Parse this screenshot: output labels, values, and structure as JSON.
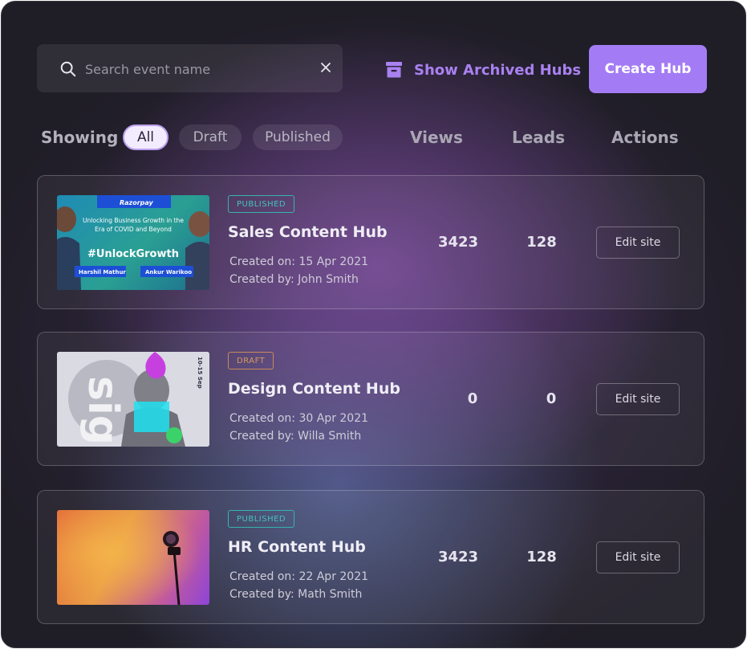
{
  "search": {
    "placeholder": "Search event name"
  },
  "header": {
    "archived_label": "Show Archived Hubs",
    "create_label": "Create Hub"
  },
  "filters": {
    "showing_label": "Showing",
    "tabs": [
      "All",
      "Draft",
      "Published"
    ],
    "active": "All"
  },
  "columns": {
    "views": "Views",
    "leads": "Leads",
    "actions": "Actions"
  },
  "hubs": [
    {
      "status": "PUBLISHED",
      "title": "Sales Content Hub",
      "created_on": "Created on: 15 Apr 2021",
      "created_by": "Created by: John Smith",
      "views": "3423",
      "leads": "128",
      "action": "Edit site",
      "thumb": {
        "brand": "Razorpay",
        "headline": "Unlocking Business Growth in the Era of COVID and Beyond",
        "hashtag": "#UnlockGrowth",
        "speaker1": "Harshil Mathur",
        "speaker2": "Ankur Warikoo"
      }
    },
    {
      "status": "DRAFT",
      "title": "Design Content Hub",
      "created_on": "Created on: 30 Apr 2021",
      "created_by": "Created by: Willa Smith",
      "views": "0",
      "leads": "0",
      "action": "Edit site",
      "thumb": {
        "big_text": "sign",
        "side_text": "10-15 Sep"
      }
    },
    {
      "status": "PUBLISHED",
      "title": "HR Content Hub",
      "created_on": "Created on: 22 Apr 2021",
      "created_by": "Created by: Math Smith",
      "views": "3423",
      "leads": "128",
      "action": "Edit site"
    }
  ],
  "colors": {
    "accent": "#a37cf5",
    "published": "#45c2bb",
    "draft": "#d8985f"
  }
}
